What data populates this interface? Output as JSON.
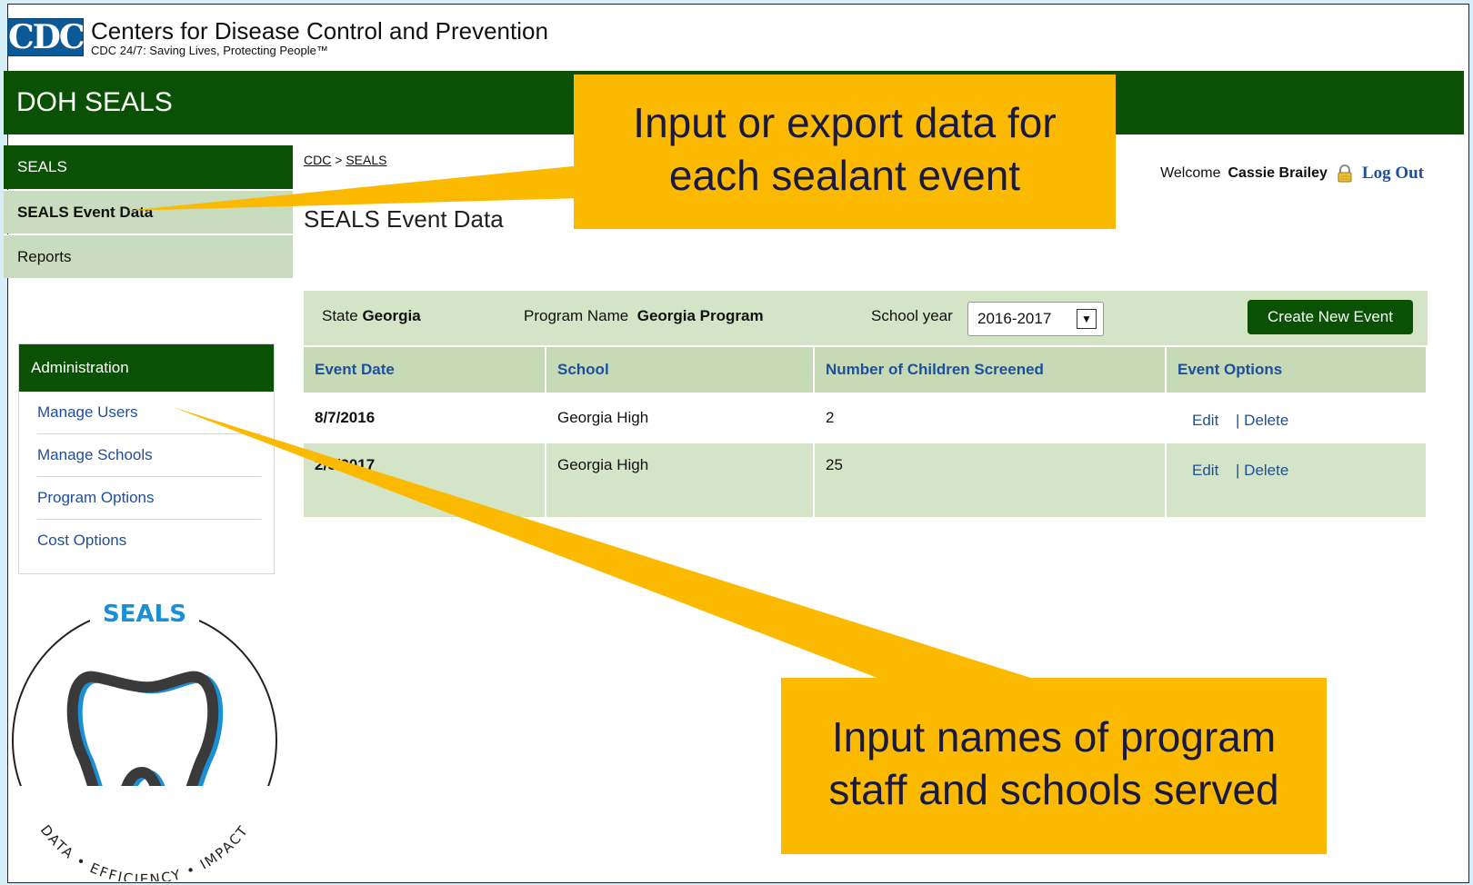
{
  "header": {
    "logo_text": "CDC",
    "org_name": "Centers for Disease Control and Prevention",
    "tagline": "CDC 24/7: Saving Lives, Protecting People™"
  },
  "app": {
    "title": "DOH SEALS"
  },
  "sidebar": {
    "section": "SEALS",
    "items": [
      {
        "label": "SEALS Event Data",
        "active": true
      },
      {
        "label": "Reports",
        "active": false
      }
    ]
  },
  "admin": {
    "title": "Administration",
    "links": [
      "Manage Users",
      "Manage Schools",
      "Program Options",
      "Cost Options"
    ]
  },
  "logo": {
    "top_text": "SEALS",
    "bottom_text": "DATA • EFFICIENCY • IMPACT"
  },
  "breadcrumb": {
    "root": "CDC",
    "separator": ">",
    "current": "SEALS"
  },
  "page": {
    "title": "SEALS Event Data"
  },
  "user": {
    "welcome": "Welcome",
    "name": "Cassie Brailey",
    "logout": "Log Out"
  },
  "filters": {
    "state_label": "State",
    "state_value": "Georgia",
    "program_label": "Program Name",
    "program_value": "Georgia Program",
    "year_label": "School year",
    "year_value": "2016-2017",
    "create_button": "Create New Event"
  },
  "table": {
    "columns": [
      "Event Date",
      "School",
      "Number of Children Screened",
      "Event Options"
    ],
    "rows": [
      {
        "date": "8/7/2016",
        "school": "Georgia High",
        "screened": "2",
        "edit": "Edit",
        "delete": "| Delete"
      },
      {
        "date": "2/6/2017",
        "school": "Georgia High",
        "screened": "25",
        "edit": "Edit",
        "delete": "| Delete"
      }
    ]
  },
  "callouts": {
    "top_line1": "Input or export data for",
    "top_line2": "each sealant event",
    "bottom_line1": "Input names of program",
    "bottom_line2": "staff and schools served"
  },
  "colors": {
    "cdc_green": "#0b5105",
    "nav_light": "#c9dcbd",
    "link_blue": "#1e4f9c",
    "callout_yellow": "#fbb900",
    "backdrop": "#d6eef8"
  }
}
